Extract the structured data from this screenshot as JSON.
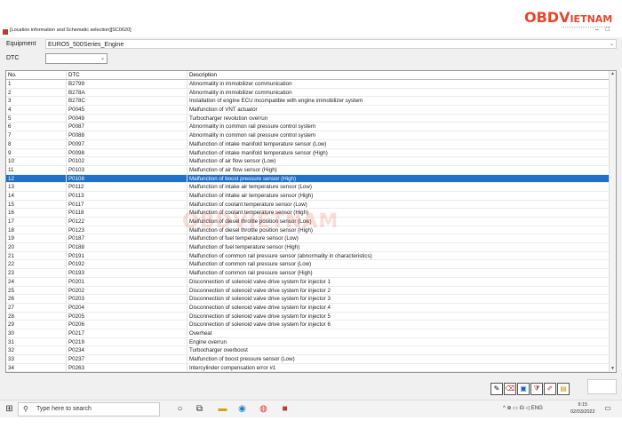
{
  "window": {
    "title": "[Location information and Schematic selection][SC0620]",
    "logo": {
      "left": "OBD",
      "v": "V",
      "right": "IETNAM"
    }
  },
  "equipment": {
    "label": "Equipment",
    "value": "EURO5_500Series_Engine"
  },
  "dtc_filter": {
    "label": "DTC",
    "value": ""
  },
  "table": {
    "headers": [
      "No.",
      "DTC",
      "Description"
    ],
    "selected_index": 11,
    "rows": [
      [
        "1",
        "B2799",
        "Abnormality in immobilizer communication"
      ],
      [
        "2",
        "B278A",
        "Abnormality in immobilizer communication"
      ],
      [
        "3",
        "B278C",
        "Installation of engine ECU incompatible with engine immobilizer system"
      ],
      [
        "4",
        "P0045",
        "Malfunction of VNT actuator"
      ],
      [
        "5",
        "P0049",
        "Turbocharger revolution overrun"
      ],
      [
        "6",
        "P0087",
        "Abnormality in common rail pressure control system"
      ],
      [
        "7",
        "P0088",
        "Abnormality in common rail pressure control system"
      ],
      [
        "8",
        "P0097",
        "Malfunction of intake manifold temperature sensor (Low)"
      ],
      [
        "9",
        "P0098",
        "Malfunction of intake manifold temperature sensor (High)"
      ],
      [
        "10",
        "P0102",
        "Malfunction of air flow sensor (Low)"
      ],
      [
        "11",
        "P0103",
        "Malfunction of air flow sensor (High)"
      ],
      [
        "12",
        "P0108",
        "Malfunction of boost pressure sensor (High)"
      ],
      [
        "13",
        "P0112",
        "Malfunction of intake air temperature sensor (Low)"
      ],
      [
        "14",
        "P0113",
        "Malfunction of intake air temperature sensor (High)"
      ],
      [
        "15",
        "P0117",
        "Malfunction of coolant temperature sensor (Low)"
      ],
      [
        "16",
        "P0118",
        "Malfunction of coolant temperature sensor (High)"
      ],
      [
        "17",
        "P0122",
        "Malfunction of diesel throttle position sensor (Low)"
      ],
      [
        "18",
        "P0123",
        "Malfunction of diesel throttle position sensor (High)"
      ],
      [
        "19",
        "P0187",
        "Malfunction of fuel temperature sensor (Low)"
      ],
      [
        "20",
        "P0188",
        "Malfunction of fuel temperature sensor (High)"
      ],
      [
        "21",
        "P0191",
        "Malfunction of common rail pressure sensor (abnormality in characteristics)"
      ],
      [
        "22",
        "P0192",
        "Malfunction of common rail pressure sensor (Low)"
      ],
      [
        "23",
        "P0193",
        "Malfunction of common rail pressure sensor (High)"
      ],
      [
        "24",
        "P0201",
        "Disconnection of solenoid valve drive system for injector 1"
      ],
      [
        "25",
        "P0202",
        "Disconnection of solenoid valve drive system for injector 2"
      ],
      [
        "26",
        "P0203",
        "Disconnection of solenoid valve drive system for injector 3"
      ],
      [
        "27",
        "P0204",
        "Disconnection of solenoid valve drive system for injector 4"
      ],
      [
        "28",
        "P0205",
        "Disconnection of solenoid valve drive system for injector 5"
      ],
      [
        "29",
        "P0206",
        "Disconnection of solenoid valve drive system for injector 6"
      ],
      [
        "30",
        "P0217",
        "Overheat"
      ],
      [
        "31",
        "P0219",
        "Engine overrun"
      ],
      [
        "32",
        "P0234",
        "Turbocharger overboost"
      ],
      [
        "33",
        "P0237",
        "Malfunction of boost pressure sensor (Low)"
      ],
      [
        "34",
        "P0263",
        "Intercylinder compensation error #1"
      ]
    ]
  },
  "watermark": "OBDVIETNAM",
  "taskbar": {
    "search_placeholder": "Type here to search",
    "tray_lang": "ENG",
    "time": "9:15",
    "date": "02/03/2022"
  },
  "colors": {
    "selection": "#1e70c8",
    "brand": "#e8452c"
  },
  "icons": [
    "windows-start-icon",
    "search-icon",
    "cortana-icon",
    "task-view-icon",
    "file-explorer-icon",
    "edge-icon",
    "chrome-icon",
    "app-icon",
    "notification-icon"
  ]
}
